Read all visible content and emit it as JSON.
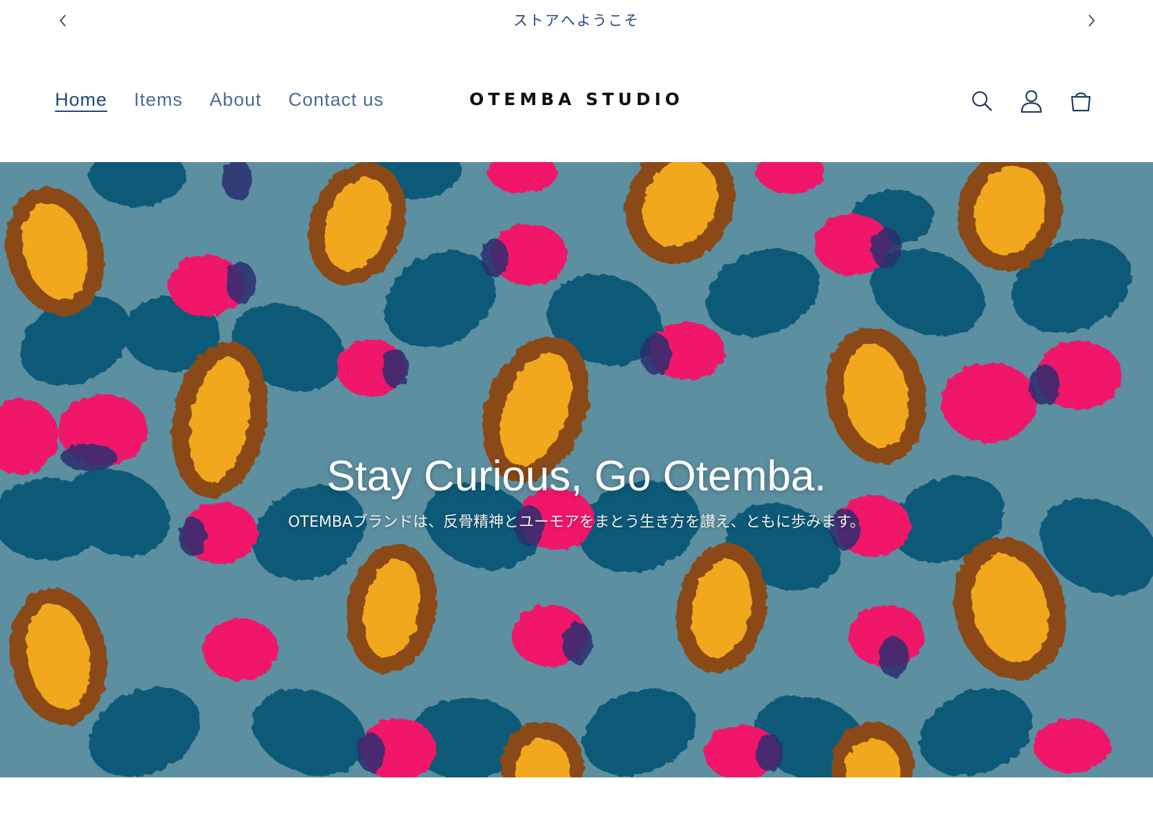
{
  "announcement": {
    "text": "ストアへようこそ",
    "prev_icon": "chevron-left-icon",
    "next_icon": "chevron-right-icon"
  },
  "header": {
    "logo": "OTEMBA STUDIO",
    "nav": [
      {
        "label": "Home",
        "active": true
      },
      {
        "label": "Items",
        "active": false
      },
      {
        "label": "About",
        "active": false
      },
      {
        "label": "Contact us",
        "active": false
      }
    ],
    "icons": [
      "search-icon",
      "account-icon",
      "cart-icon"
    ]
  },
  "hero": {
    "title": "Stay Curious, Go Otemba.",
    "subtitle": "OTEMBAブランドは、反骨精神とユーモアをまとう生き方を讃え、ともに歩みます。"
  },
  "colors": {
    "text_nav": "#4b6a94",
    "text_active": "#1d4779",
    "hero_bg": "#5c8fa0",
    "pattern_teal": "#0f5a78",
    "pattern_pink": "#f0186a",
    "pattern_brown": "#8a4a12",
    "pattern_yellow": "#f2a81c"
  }
}
